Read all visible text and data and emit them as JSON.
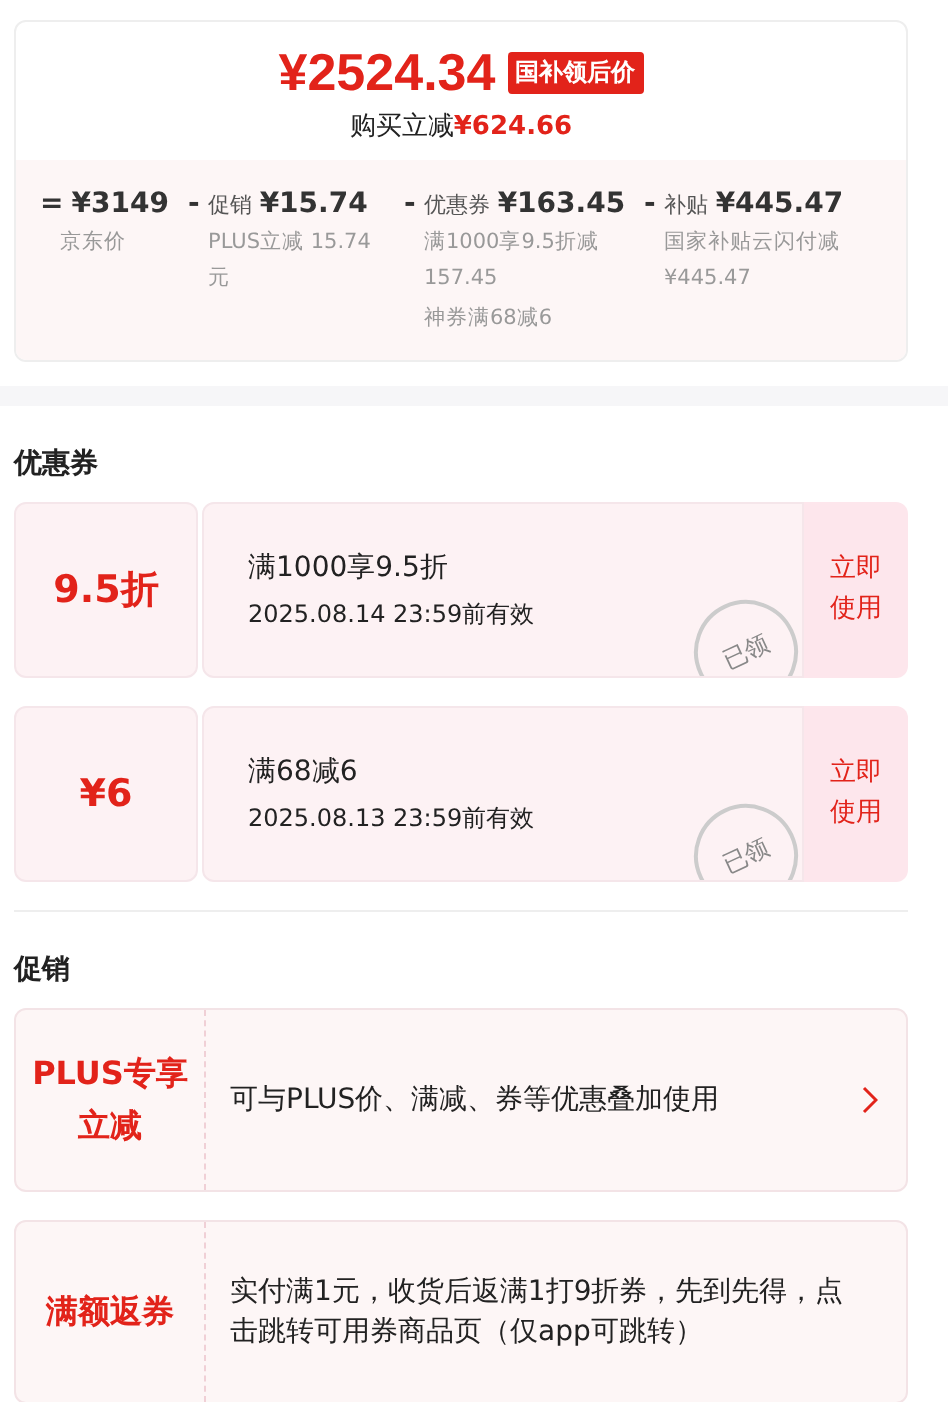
{
  "price_card": {
    "final_price": "¥2524.34",
    "price_tag": "国补领后价",
    "saving_label": "购买立减",
    "saving_amount": "¥624.66",
    "breakdown": [
      {
        "operator": "=",
        "amount": "¥3149",
        "notes": [
          "京东价"
        ]
      },
      {
        "operator": "-",
        "label": "促销",
        "amount": "¥15.74",
        "notes": [
          "PLUS立减 15.74元"
        ]
      },
      {
        "operator": "-",
        "label": "优惠券",
        "amount": "¥163.45",
        "notes": [
          "满1000享9.5折减157.45",
          "神券满68减6"
        ]
      },
      {
        "operator": "-",
        "label": "补贴",
        "amount": "¥445.47",
        "notes": [
          "国家补贴云闪付减¥445.47"
        ]
      }
    ]
  },
  "coupons": {
    "title": "优惠券",
    "items": [
      {
        "value": "9.5折",
        "condition": "满1000享9.5折",
        "validity": "2025.08.14 23:59前有效",
        "stamp": "已领",
        "action": "立即使用"
      },
      {
        "value": "¥6",
        "condition": "满68减6",
        "validity": "2025.08.13 23:59前有效",
        "stamp": "已领",
        "action": "立即使用"
      }
    ]
  },
  "promotions": {
    "title": "促销",
    "items": [
      {
        "name": "PLUS专享立减",
        "description": "可与PLUS价、满减、券等优惠叠加使用",
        "has_arrow": true
      },
      {
        "name": "满额返券",
        "description": "实付满1元，收货后返满1打9折券，先到先得，点击跳转可用券商品页（仅app可跳转）",
        "has_arrow": false
      }
    ]
  }
}
